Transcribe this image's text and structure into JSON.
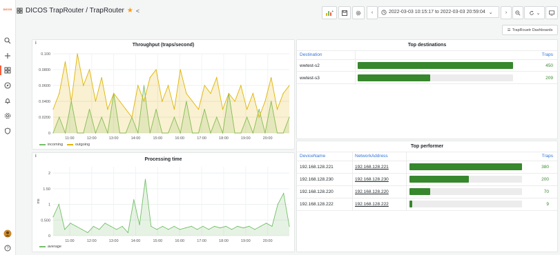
{
  "app": {
    "logo_text": "DICOS",
    "breadcrumb": "DICOS TrapRouter / TrapRouter",
    "time_range": "2022-03-03 10:15:17 to 2022-03-03 20:59:04",
    "dashboards_link": "TrapRouetr Dashboards"
  },
  "colors": {
    "accent": "#37872d",
    "star": "#ff9900",
    "incoming": "#73bf69",
    "outgoing": "#e0b400",
    "link": "#3274d9"
  },
  "sidebar_icons": [
    "search-icon",
    "plus-icon",
    "dashboards-icon",
    "explore-icon",
    "alerting-icon",
    "settings-icon",
    "shield-icon",
    "avatar",
    "help-icon"
  ],
  "throughput": {
    "title": "Throughput (traps/second)",
    "info": "i",
    "legend": [
      {
        "name": "incoming",
        "color": "#73bf69"
      },
      {
        "name": "outgoing",
        "color": "#e0b400"
      }
    ]
  },
  "processing": {
    "title": "Processing time",
    "info": "i",
    "ylabel": "ms",
    "legend": [
      {
        "name": "average",
        "color": "#73bf69"
      }
    ]
  },
  "top_destinations": {
    "title": "Top destinations",
    "headers": {
      "destination": "Destination",
      "traps": "Traps"
    },
    "max": 450,
    "rows": [
      {
        "destination": "wwtest-s2",
        "traps": "450",
        "value": 450
      },
      {
        "destination": "wwtest-s3",
        "traps": "209",
        "value": 209
      }
    ]
  },
  "top_performer": {
    "title": "Top performer",
    "headers": {
      "device": "DeviceName",
      "address": "NetworkAddress",
      "traps": "Traps"
    },
    "max": 380,
    "rows": [
      {
        "device": "192.168.128.221",
        "address": "192.168.128.221",
        "traps": "380",
        "value": 380
      },
      {
        "device": "192.168.128.230",
        "address": "192.168.128.230",
        "traps": "200",
        "value": 200
      },
      {
        "device": "192.168.128.220",
        "address": "192.168.128.220",
        "traps": "70",
        "value": 70
      },
      {
        "device": "192.168.128.222",
        "address": "192.168.128.222",
        "traps": "9",
        "value": 9
      }
    ]
  },
  "chart_data": [
    {
      "type": "line",
      "title": "Throughput (traps/second)",
      "x": [
        "11:00",
        "12:00",
        "13:00",
        "14:00",
        "15:00",
        "16:00",
        "17:00",
        "18:00",
        "19:00",
        "20:00"
      ],
      "yticks": [
        "0",
        "0.0200",
        "0.0400",
        "0.0600",
        "0.0800",
        "0.100"
      ],
      "ylim": [
        0,
        0.1
      ],
      "xlim": [
        "10:15",
        "20:59"
      ],
      "series": [
        {
          "name": "incoming",
          "values": [
            0.0,
            0.02,
            0.0,
            0.04,
            0.0,
            0.0,
            0.03,
            0.0,
            0.02,
            0.0,
            0.05,
            0.0,
            0.0,
            0.02,
            0.0,
            0.06,
            0.0,
            0.03,
            0.0,
            0.0,
            0.02,
            0.0,
            0.04,
            0.0,
            0.0,
            0.03,
            0.0,
            0.02,
            0.0,
            0.05,
            0.0,
            0.0,
            0.02,
            0.0,
            0.03,
            0.0,
            0.04,
            0.0,
            0.0,
            0.02
          ]
        },
        {
          "name": "outgoing",
          "values": [
            0.03,
            0.05,
            0.09,
            0.04,
            0.1,
            0.06,
            0.08,
            0.04,
            0.07,
            0.03,
            0.05,
            0.04,
            0.03,
            0.02,
            0.06,
            0.04,
            0.07,
            0.08,
            0.04,
            0.06,
            0.03,
            0.08,
            0.05,
            0.04,
            0.03,
            0.06,
            0.05,
            0.07,
            0.03,
            0.05,
            0.04,
            0.06,
            0.03,
            0.05,
            0.02,
            0.04,
            0.07,
            0.03,
            0.05,
            0.06
          ]
        }
      ]
    },
    {
      "type": "line",
      "title": "Processing time",
      "ylabel": "ms",
      "x": [
        "11:00",
        "12:00",
        "13:00",
        "14:00",
        "15:00",
        "16:00",
        "17:00",
        "18:00",
        "19:00",
        "20:00"
      ],
      "yticks": [
        "0",
        "0.500",
        "1",
        "1.50",
        "2"
      ],
      "ylim": [
        0,
        2.2
      ],
      "xlim": [
        "10:15",
        "20:59"
      ],
      "series": [
        {
          "name": "average",
          "values": [
            0.6,
            1.0,
            0.2,
            0.4,
            0.3,
            0.2,
            0.1,
            0.3,
            0.2,
            0.4,
            0.3,
            0.2,
            0.3,
            0.1,
            1.15,
            0.35,
            1.8,
            0.3,
            0.2,
            0.3,
            0.2,
            0.3,
            0.2,
            0.25,
            0.3,
            0.2,
            0.3,
            0.2,
            0.3,
            0.25,
            0.3,
            0.2,
            0.3,
            0.25,
            0.3,
            0.2,
            0.3,
            0.4,
            0.3,
            1.0,
            1.35,
            0.3
          ]
        }
      ]
    }
  ]
}
